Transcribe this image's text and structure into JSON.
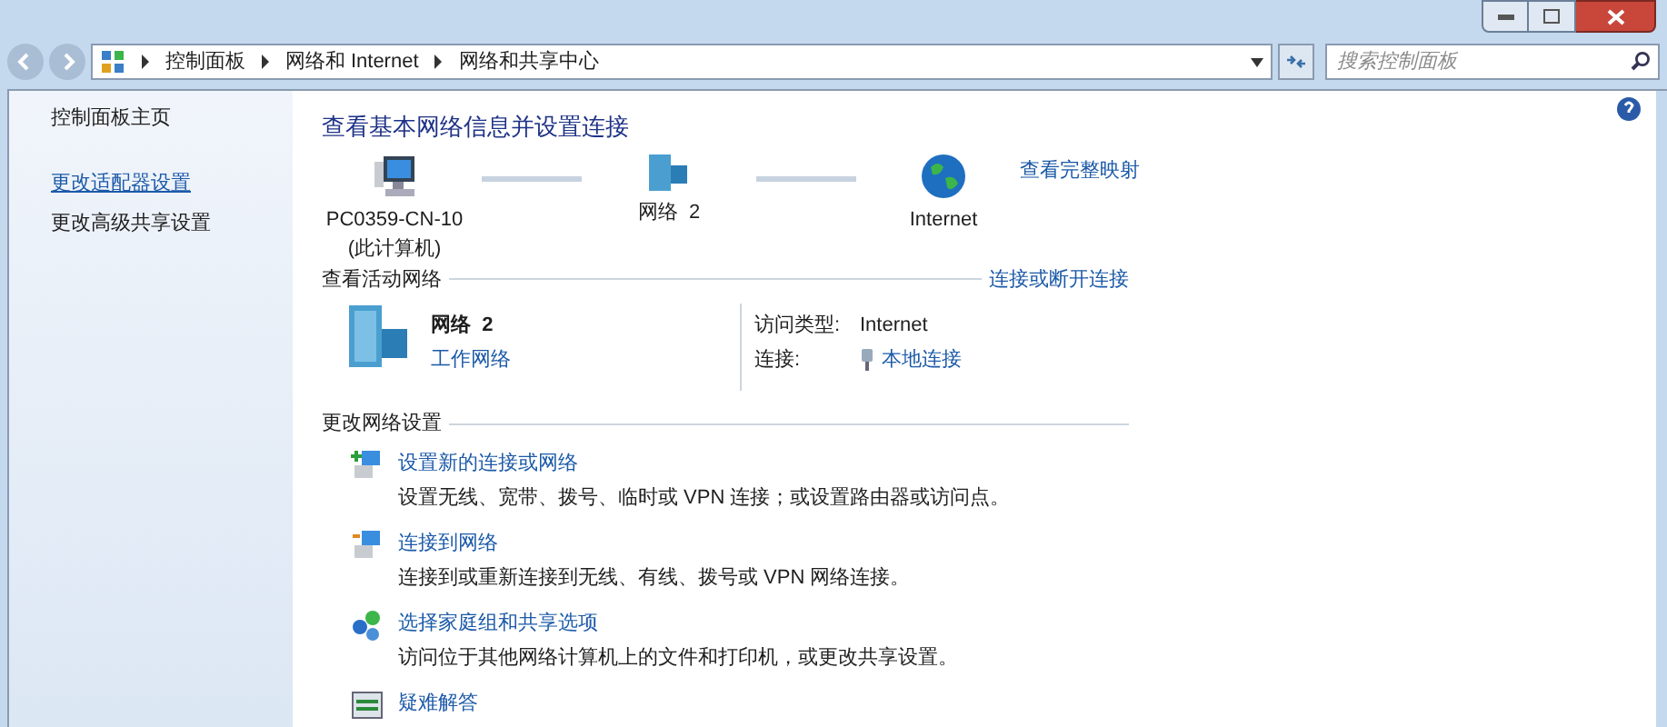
{
  "address_bar": {
    "breadcrumbs": [
      "控制面板",
      "网络和 Internet",
      "网络和共享中心"
    ]
  },
  "search": {
    "placeholder": "搜索控制面板"
  },
  "sidebar": {
    "items": [
      {
        "label": "控制面板主页",
        "hovered": false
      },
      {
        "label": "更改适配器设置",
        "hovered": true
      },
      {
        "label": "更改高级共享设置",
        "hovered": false
      }
    ]
  },
  "heading": "查看基本网络信息并设置连接",
  "map": {
    "link": "查看完整映射",
    "nodes": [
      {
        "kind": "computer",
        "label": "PC0359-CN-10",
        "sublabel": "(此计算机)"
      },
      {
        "kind": "network",
        "label": "网络  2"
      },
      {
        "kind": "internet",
        "label": "Internet"
      }
    ]
  },
  "active_networks": {
    "title": "查看活动网络",
    "link": "连接或断开连接",
    "networks": [
      {
        "name": "网络  2",
        "type": "工作网络",
        "access_label": "访问类型:",
        "access": "Internet",
        "connection_label": "连接:",
        "connection": "本地连接"
      }
    ]
  },
  "settings": {
    "title": "更改网络设置",
    "tasks": [
      {
        "kind": "new-connection",
        "title": "设置新的连接或网络",
        "description": "设置无线、宽带、拨号、临时或 VPN 连接；或设置路由器或访问点。"
      },
      {
        "kind": "connect",
        "title": "连接到网络",
        "description": "连接到或重新连接到无线、有线、拨号或 VPN 网络连接。"
      },
      {
        "kind": "homegroup",
        "title": "选择家庭组和共享选项",
        "description": "访问位于其他网络计算机上的文件和打印机，或更改共享设置。"
      },
      {
        "kind": "troubleshoot",
        "title": "疑难解答"
      }
    ]
  }
}
